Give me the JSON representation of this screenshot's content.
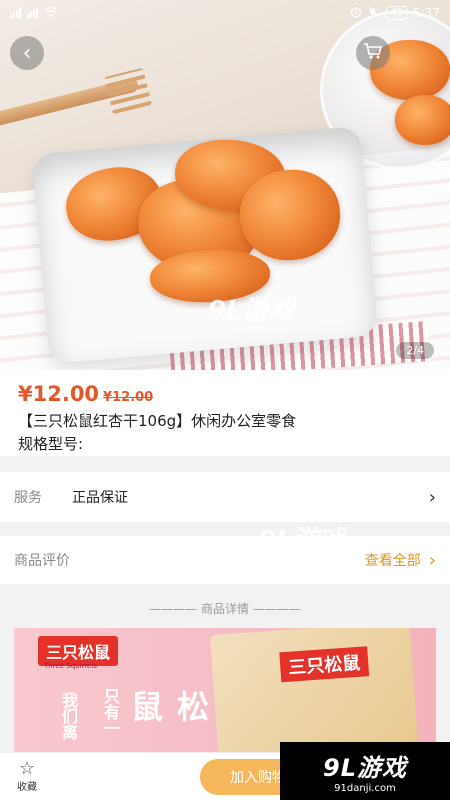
{
  "status_bar": {
    "battery": "49",
    "time": "5:37",
    "icons": [
      "signal-icon",
      "wifi-icon",
      "alarm-icon",
      "mute-icon"
    ]
  },
  "hero": {
    "image_counter": "2/4",
    "back_icon": "back-arrow-icon",
    "cart_icon": "cart-icon"
  },
  "product": {
    "price": "¥12.00",
    "old_price": "¥12.00",
    "title": "【三只松鼠红杏干106g】休闲办公室零食",
    "spec_label": "规格型号:"
  },
  "service": {
    "label": "服务",
    "value": "正品保证"
  },
  "reviews": {
    "label": "商品评价",
    "link": "查看全部"
  },
  "details_divider": "———— 商品详情 ————",
  "banner": {
    "brand": "三只松鼠",
    "brand_sub": "Three Squirrels",
    "text1": "我们离",
    "text2": "只有一",
    "big": "松鼠",
    "package_brand": "三只松鼠"
  },
  "bottom_bar": {
    "favorite_label": "收藏",
    "add_to_cart": "加入购物车"
  },
  "watermark": {
    "logo": "9L游戏",
    "domain": "91danji.com"
  },
  "colors": {
    "price": "#e5572a",
    "review_link": "#e09520",
    "add_cart_bg": "#f6b75a"
  }
}
